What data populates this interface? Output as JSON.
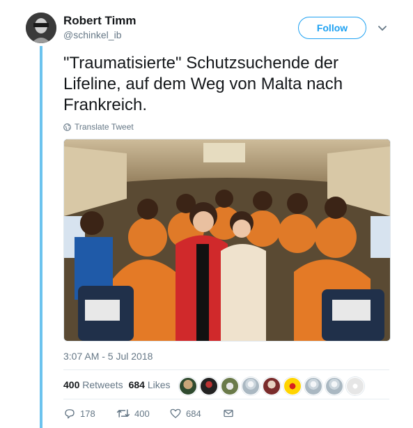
{
  "user": {
    "name": "Robert Timm",
    "handle": "@schinkel_ib"
  },
  "follow_label": "Follow",
  "tweet": {
    "text": "\"Traumatisierte\" Schutzsuchende der Lifeline, auf dem Weg von Malta nach Frankreich.",
    "translate_label": "Translate Tweet",
    "timestamp": "3:07 AM - 5 Jul 2018"
  },
  "stats": {
    "retweets_count": "400",
    "retweets_label": "Retweets",
    "likes_count": "684",
    "likes_label": "Likes"
  },
  "actions": {
    "reply_count": "178",
    "retweet_count": "400",
    "like_count": "684"
  },
  "colors": {
    "brand": "#1da1f2",
    "thread_line": "#6cc3ee",
    "muted": "#657786"
  },
  "icons": [
    "caret-down-icon",
    "globe-icon",
    "reply-icon",
    "retweet-icon",
    "heart-icon",
    "message-icon"
  ]
}
